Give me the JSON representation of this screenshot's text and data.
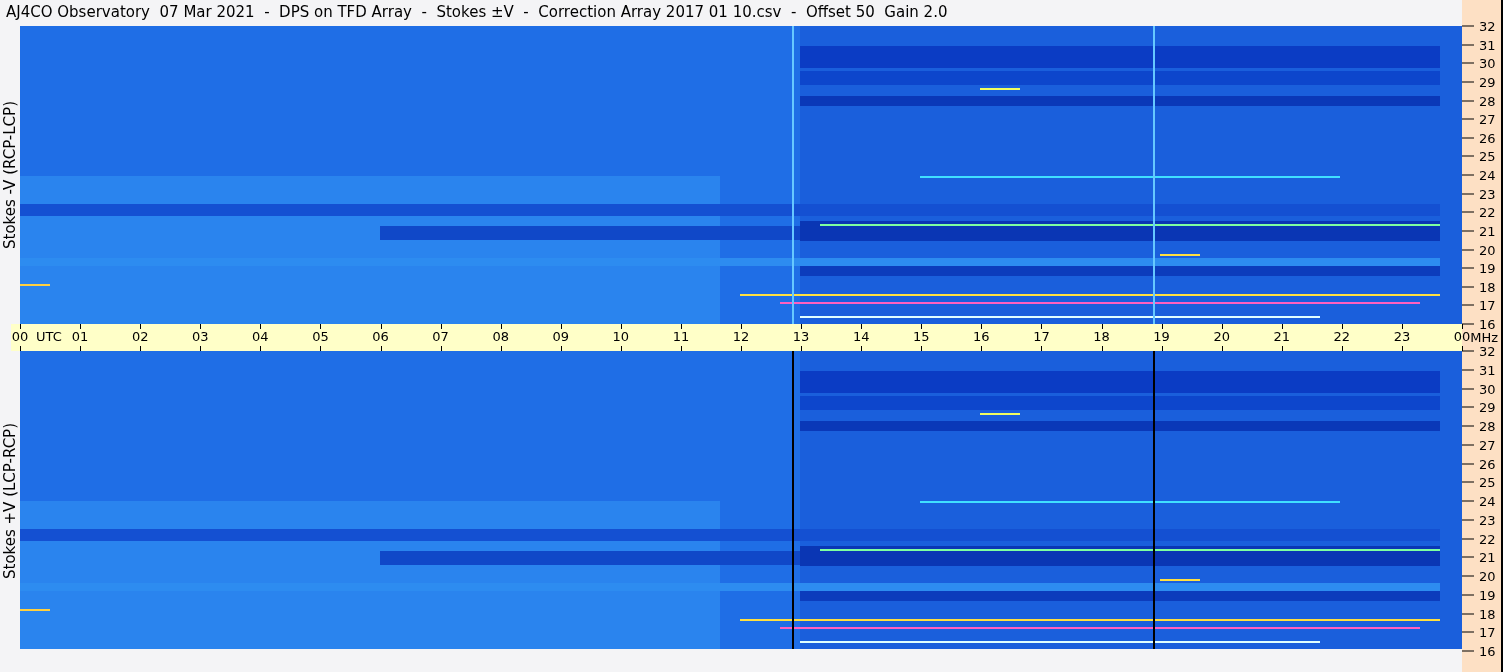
{
  "title": "AJ4CO Observatory  07 Mar 2021  -  DPS on TFD Array  -  Stokes ±V  -  Correction Array 2017 01 10.csv  -  Offset 50  Gain 2.0",
  "panels": [
    {
      "label": "Stokes -V (RCP-LCP)",
      "kind": "minus",
      "frequency_ticks": [
        "32",
        "31",
        "30",
        "29",
        "28",
        "27",
        "26",
        "25",
        "24",
        "23",
        "22",
        "21",
        "20",
        "19",
        "18",
        "17",
        "16"
      ]
    },
    {
      "label": "Stokes +V (LCP-RCP)",
      "kind": "plus",
      "frequency_ticks": [
        "32",
        "31",
        "30",
        "29",
        "28",
        "27",
        "26",
        "25",
        "24",
        "23",
        "22",
        "21",
        "20",
        "19",
        "18",
        "17",
        "16"
      ]
    }
  ],
  "time_axis": {
    "unit": "UTC",
    "frequency_unit": "MHz",
    "ticks": [
      "00",
      "01",
      "02",
      "03",
      "04",
      "05",
      "06",
      "07",
      "08",
      "09",
      "10",
      "11",
      "12",
      "13",
      "14",
      "15",
      "16",
      "17",
      "18",
      "19",
      "20",
      "21",
      "22",
      "23",
      "00"
    ]
  }
}
